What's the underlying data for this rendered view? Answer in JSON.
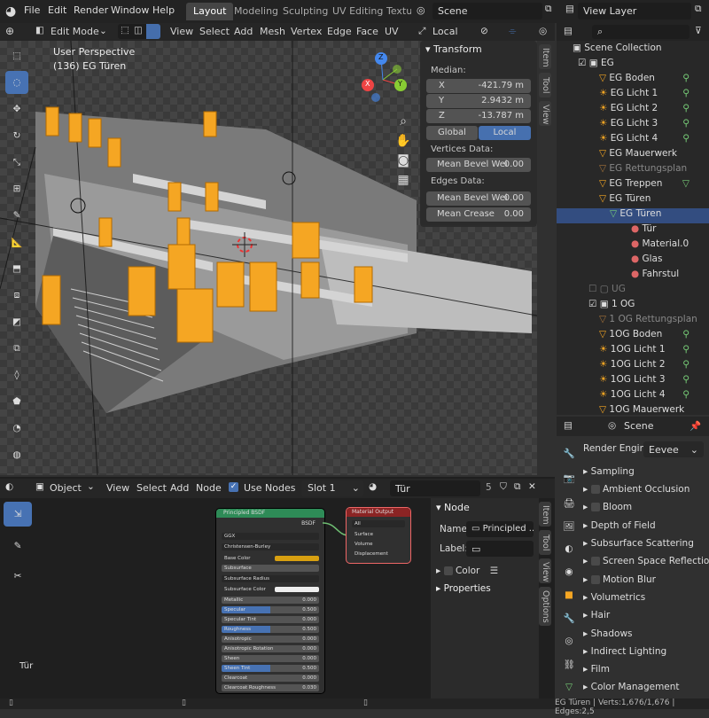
{
  "menubar": {
    "items": [
      "File",
      "Edit",
      "Render",
      "Window",
      "Help"
    ],
    "workspace_tabs": [
      "Layout",
      "Modeling",
      "Sculpting",
      "UV Editing",
      "Textu"
    ],
    "scene": "Scene",
    "view_layer": "View Layer"
  },
  "viewport": {
    "mode": "Edit Mode",
    "menus": [
      "View",
      "Select",
      "Add",
      "Mesh",
      "Vertex",
      "Edge",
      "Face",
      "UV"
    ],
    "orientation": "Local",
    "info_line1": "User Perspective",
    "info_line2": "(136) EG Türen",
    "gizmo": {
      "x": "X",
      "y": "Y",
      "z": "Z"
    }
  },
  "npanel": {
    "tabs": [
      "Item",
      "Tool",
      "View"
    ],
    "title": "Transform",
    "median_label": "Median:",
    "x_label": "X",
    "x": "-421.79 m",
    "y_label": "Y",
    "y": "2.9432 m",
    "z_label": "Z",
    "z": "-13.787 m",
    "global": "Global",
    "local": "Local",
    "vertices_label": "Vertices Data:",
    "v_bevel": "Mean Bevel Wei",
    "v_bevel_val": "0.00",
    "edges_label": "Edges Data:",
    "e_bevel": "Mean Bevel Wei",
    "e_bevel_val": "0.00",
    "e_crease": "Mean Crease",
    "e_crease_val": "0.00"
  },
  "outliner": {
    "root": "Scene Collection",
    "items": [
      "EG",
      "EG Boden",
      "EG Licht 1",
      "EG Licht 2",
      "EG Licht 3",
      "EG Licht 4",
      "EG Mauerwerk",
      "EG Rettungsplan",
      "EG Treppen",
      "EG Türen",
      "EG Türen",
      "Tür",
      "Material.0",
      "Glas",
      "Fahrstul",
      "UG",
      "1 OG",
      "1 OG Rettungsplan",
      "1OG Boden",
      "1OG Licht 1",
      "1OG Licht 2",
      "1OG Licht 3",
      "1OG Licht 4",
      "1OG Mauerwerk"
    ]
  },
  "properties": {
    "header": "Scene",
    "render_engine_label": "Render Engine",
    "render_engine": "Eevee",
    "sections": [
      "Sampling",
      "Ambient Occlusion",
      "Bloom",
      "Depth of Field",
      "Subsurface Scattering",
      "Screen Space Reflection",
      "Motion Blur",
      "Volumetrics",
      "Hair",
      "Shadows",
      "Indirect Lighting",
      "Film",
      "Color Management"
    ]
  },
  "node_editor": {
    "object": "Object",
    "menus": [
      "View",
      "Select",
      "Add",
      "Node"
    ],
    "use_nodes": "Use Nodes",
    "slot": "Slot 1",
    "material": "Tür",
    "users": "5",
    "material_label": "Tür",
    "bsdf": {
      "title": "Principled BSDF",
      "out": "BSDF",
      "dist": "GGX",
      "sss": "Christensen-Burley",
      "rows": [
        [
          "Base Color",
          ""
        ],
        [
          "Subsurface",
          ""
        ],
        [
          "Subsurface Radius",
          ""
        ],
        [
          "Subsurface Color",
          ""
        ],
        [
          "Metallic",
          "0.000"
        ],
        [
          "Specular",
          "0.500"
        ],
        [
          "Specular Tint",
          "0.000"
        ],
        [
          "Roughness",
          "0.500"
        ],
        [
          "Anisotropic",
          "0.000"
        ],
        [
          "Anisotropic Rotation",
          "0.000"
        ],
        [
          "Sheen",
          "0.000"
        ],
        [
          "Sheen Tint",
          "0.500"
        ],
        [
          "Clearcoat",
          "0.000"
        ],
        [
          "Clearcoat Roughness",
          "0.030"
        ]
      ]
    },
    "output": {
      "title": "Material Output",
      "target": "All",
      "inputs": [
        "Surface",
        "Volume",
        "Displacement"
      ]
    }
  },
  "node_sidebar": {
    "title": "Node",
    "name_label": "Name:",
    "name_value": "Principled ...",
    "label_label": "Label:",
    "color_label": "Color",
    "properties_label": "Properties",
    "tabs": [
      "Item",
      "Tool",
      "View",
      "Options"
    ]
  },
  "statusbar": {
    "text": "EG Türen | Verts:1,676/1,676 | Edges:2,5"
  },
  "colors": {
    "accent": "#4772b3",
    "orange": "#f5a623",
    "bsdf_header": "#2e8b57",
    "output_header": "#8b2424"
  }
}
